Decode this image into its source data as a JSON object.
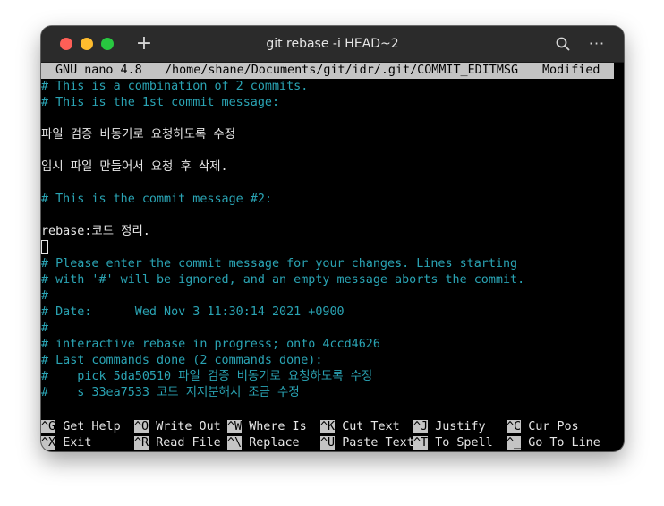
{
  "window": {
    "title": "git rebase -i HEAD~2",
    "new_tab_symbol": "+",
    "menu_symbol": "···"
  },
  "header": {
    "app": "GNU nano 4.8",
    "path": "/home/shane/Documents/git/idr/.git/COMMIT_EDITMSG",
    "status": "Modified"
  },
  "buffer": [
    {
      "text": "# This is a combination of 2 commits.",
      "kind": "comment"
    },
    {
      "text": "# This is the 1st commit message:",
      "kind": "comment"
    },
    {
      "text": "",
      "kind": "text"
    },
    {
      "text": "파일 검증 비동기로 요청하도록 수정",
      "kind": "text"
    },
    {
      "text": "",
      "kind": "text"
    },
    {
      "text": "임시 파일 만들어서 요청 후 삭제.",
      "kind": "text"
    },
    {
      "text": "",
      "kind": "text"
    },
    {
      "text": "# This is the commit message #2:",
      "kind": "comment"
    },
    {
      "text": "",
      "kind": "text"
    },
    {
      "text": "rebase:코드 정리.",
      "kind": "text"
    },
    {
      "text": "",
      "kind": "text"
    },
    {
      "text": "# Please enter the commit message for your changes. Lines starting",
      "kind": "comment"
    },
    {
      "text": "# with '#' will be ignored, and an empty message aborts the commit.",
      "kind": "comment"
    },
    {
      "text": "#",
      "kind": "comment"
    },
    {
      "text": "# Date:      Wed Nov 3 11:30:14 2021 +0900",
      "kind": "comment"
    },
    {
      "text": "#",
      "kind": "comment"
    },
    {
      "text": "# interactive rebase in progress; onto 4ccd4626",
      "kind": "comment"
    },
    {
      "text": "# Last commands done (2 commands done):",
      "kind": "comment"
    },
    {
      "text": "#    pick 5da50510 파일 검증 비동기로 요청하도록 수정",
      "kind": "comment"
    },
    {
      "text": "#    s 33ea7533 코드 지저분해서 조금 수정",
      "kind": "comment"
    }
  ],
  "shortcuts": [
    [
      {
        "key": "^G",
        "label": "Get Help"
      },
      {
        "key": "^O",
        "label": "Write Out"
      },
      {
        "key": "^W",
        "label": "Where Is"
      },
      {
        "key": "^K",
        "label": "Cut Text"
      },
      {
        "key": "^J",
        "label": "Justify"
      },
      {
        "key": "^C",
        "label": "Cur Pos"
      }
    ],
    [
      {
        "key": "^X",
        "label": "Exit"
      },
      {
        "key": "^R",
        "label": "Read File"
      },
      {
        "key": "^\\",
        "label": "Replace"
      },
      {
        "key": "^U",
        "label": "Paste Text"
      },
      {
        "key": "^T",
        "label": "To Spell"
      },
      {
        "key": "^_",
        "label": "Go To Line"
      }
    ]
  ],
  "colors": {
    "comment": "#2aa4b4",
    "text": "#e6e6e6",
    "background": "#000000",
    "status_bar": "#c4c4c4"
  }
}
